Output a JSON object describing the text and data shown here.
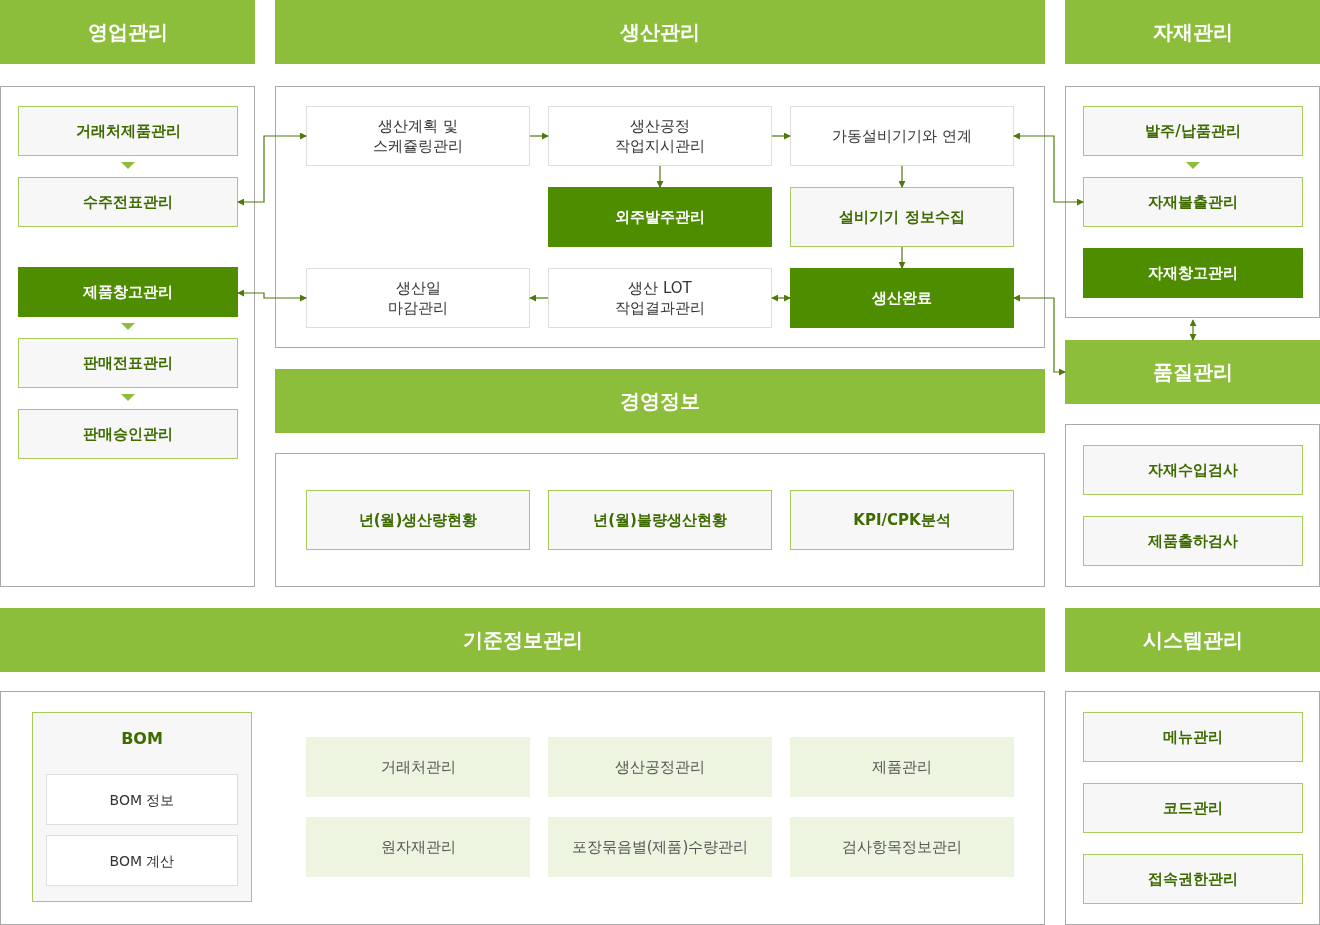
{
  "sales": {
    "title": "영업관리",
    "groups": [
      [
        {
          "label": "거래처제품관리",
          "kind": "outline"
        },
        {
          "label": "수주전표관리",
          "kind": "outline"
        }
      ],
      [
        {
          "label": "제품창고관리",
          "kind": "solid"
        },
        {
          "label": "판매전표관리",
          "kind": "outline"
        },
        {
          "label": "판매승인관리",
          "kind": "outline"
        }
      ]
    ]
  },
  "production": {
    "title": "생산관리",
    "rows": [
      [
        {
          "label": "생산계획 및\n스케쥴링관리",
          "kind": "plain"
        },
        {
          "label": "생산공정\n작업지시관리",
          "kind": "plain"
        },
        {
          "label": "가동설비기기와 연계",
          "kind": "plain"
        }
      ],
      [
        "",
        {
          "label": "외주발주관리",
          "kind": "solid"
        },
        {
          "label": "설비기기 정보수집",
          "kind": "outline"
        }
      ],
      [
        {
          "label": "생산일\n마감관리",
          "kind": "plain"
        },
        {
          "label": "생산 LOT\n작업결과관리",
          "kind": "plain"
        },
        {
          "label": "생산완료",
          "kind": "solid"
        }
      ]
    ]
  },
  "materials": {
    "title": "자재관리",
    "groups": [
      [
        {
          "label": "발주/납품관리",
          "kind": "outline"
        },
        {
          "label": "자재불출관리",
          "kind": "outline"
        }
      ],
      [
        {
          "label": "자재창고관리",
          "kind": "solid"
        }
      ]
    ]
  },
  "management_info": {
    "title": "경영정보",
    "items": [
      {
        "label": "년(월)생산량현황",
        "kind": "outline"
      },
      {
        "label": "년(월)불량생산현황",
        "kind": "outline"
      },
      {
        "label": "KPI/CPK분석",
        "kind": "outline"
      }
    ]
  },
  "quality": {
    "title": "품질관리",
    "items": [
      {
        "label": "자재수입검사",
        "kind": "outline"
      },
      {
        "label": "제품출하검사",
        "kind": "outline"
      }
    ]
  },
  "master_data": {
    "title": "기준정보관리",
    "bom": {
      "title": "BOM",
      "items": [
        "BOM 정보",
        "BOM 계산"
      ]
    },
    "items": [
      {
        "label": "거래처관리",
        "kind": "tint"
      },
      {
        "label": "생산공정관리",
        "kind": "tint"
      },
      {
        "label": "제품관리",
        "kind": "tint"
      },
      {
        "label": "원자재관리",
        "kind": "tint"
      },
      {
        "label": "포장묶음별(제품)수량관리",
        "kind": "tint"
      },
      {
        "label": "검사항목정보관리",
        "kind": "tint"
      }
    ]
  },
  "system": {
    "title": "시스템관리",
    "items": [
      {
        "label": "메뉴관리",
        "kind": "outline"
      },
      {
        "label": "코드관리",
        "kind": "outline"
      },
      {
        "label": "접속권한관리",
        "kind": "outline"
      }
    ]
  }
}
